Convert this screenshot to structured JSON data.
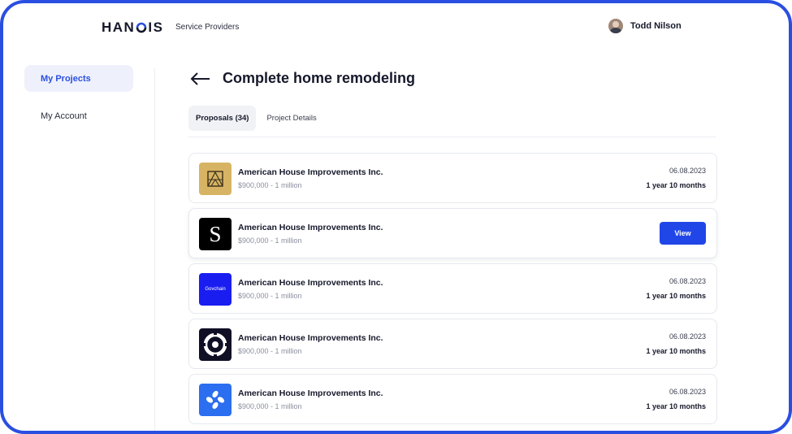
{
  "header": {
    "logo_prefix": "HAN",
    "logo_suffix": "IS",
    "nav_link": "Service Providers",
    "user_name": "Todd Nilson"
  },
  "sidebar": {
    "items": [
      {
        "label": "My Projects",
        "active": true
      },
      {
        "label": "My Account",
        "active": false
      }
    ]
  },
  "main": {
    "title": "Complete home remodeling",
    "tabs": [
      {
        "label": "Proposals (34)",
        "active": true
      },
      {
        "label": "Project Details",
        "active": false
      }
    ],
    "view_label": "View",
    "proposals": [
      {
        "name": "American House Improvements Inc.",
        "price": "$900,000 - 1 million",
        "date": "06.08.2023",
        "duration": "1 year 10 months",
        "logo": "gold-frame-logo",
        "logo_bg": "#d7b463"
      },
      {
        "name": "American House Improvements Inc.",
        "price": "$900,000 - 1 million",
        "date": "",
        "duration": "",
        "logo": "s-logo",
        "logo_bg": "#000000",
        "logo_text": "S"
      },
      {
        "name": "American House Improvements Inc.",
        "price": "$900,000 - 1 million",
        "date": "06.08.2023",
        "duration": "1 year 10 months",
        "logo": "govchain-logo",
        "logo_bg": "#1a1df0",
        "logo_text": "Govchain"
      },
      {
        "name": "American House Improvements Inc.",
        "price": "$900,000 - 1 million",
        "date": "06.08.2023",
        "duration": "1 year 10 months",
        "logo": "target-ring-logo",
        "logo_bg": "#0f0f26"
      },
      {
        "name": "American House Improvements Inc.",
        "price": "$900,000 - 1 million",
        "date": "06.08.2023",
        "duration": "1 year 10 months",
        "logo": "blue-star-logo",
        "logo_bg": "#2b6ef0"
      }
    ]
  },
  "colors": {
    "frame": "#2a4fe0",
    "accent": "#2146e8",
    "sidebar_active_bg": "#eef1fb"
  }
}
